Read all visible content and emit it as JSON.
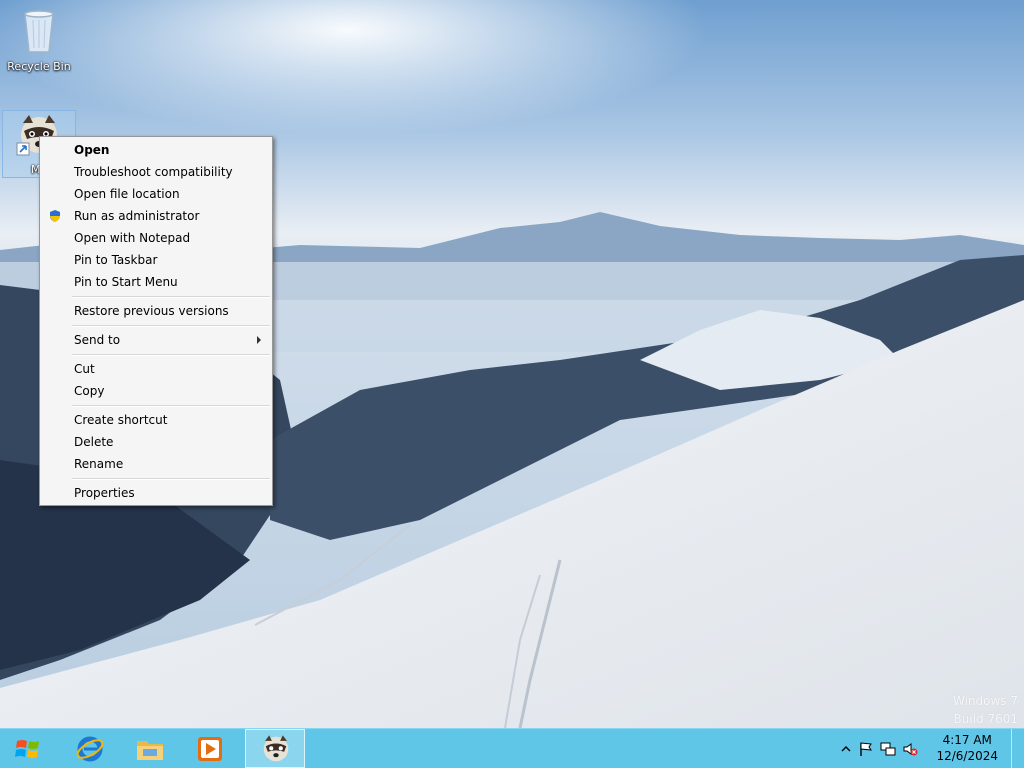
{
  "desktop": {
    "icons": [
      {
        "label": "Recycle Bin"
      },
      {
        "label": "My"
      }
    ]
  },
  "context_menu": {
    "items": [
      {
        "label": "Open"
      },
      {
        "label": "Troubleshoot compatibility"
      },
      {
        "label": "Open file location"
      },
      {
        "label": "Run as administrator"
      },
      {
        "label": "Open with Notepad"
      },
      {
        "label": "Pin to Taskbar"
      },
      {
        "label": "Pin to Start Menu"
      },
      {
        "label": "Restore previous versions"
      },
      {
        "label": "Send to"
      },
      {
        "label": "Cut"
      },
      {
        "label": "Copy"
      },
      {
        "label": "Create shortcut"
      },
      {
        "label": "Delete"
      },
      {
        "label": "Rename"
      },
      {
        "label": "Properties"
      }
    ]
  },
  "watermark": {
    "line1": "Windows 7",
    "line2": "Build 7601"
  },
  "taskbar": {
    "clock_time": "4:17 AM",
    "clock_date": "12/6/2024",
    "buttons": [
      "start-orb-icon",
      "internet-explorer-icon",
      "file-explorer-icon",
      "media-player-icon",
      "raccoon-app-icon"
    ],
    "accent_color": "#5fc6e8"
  }
}
